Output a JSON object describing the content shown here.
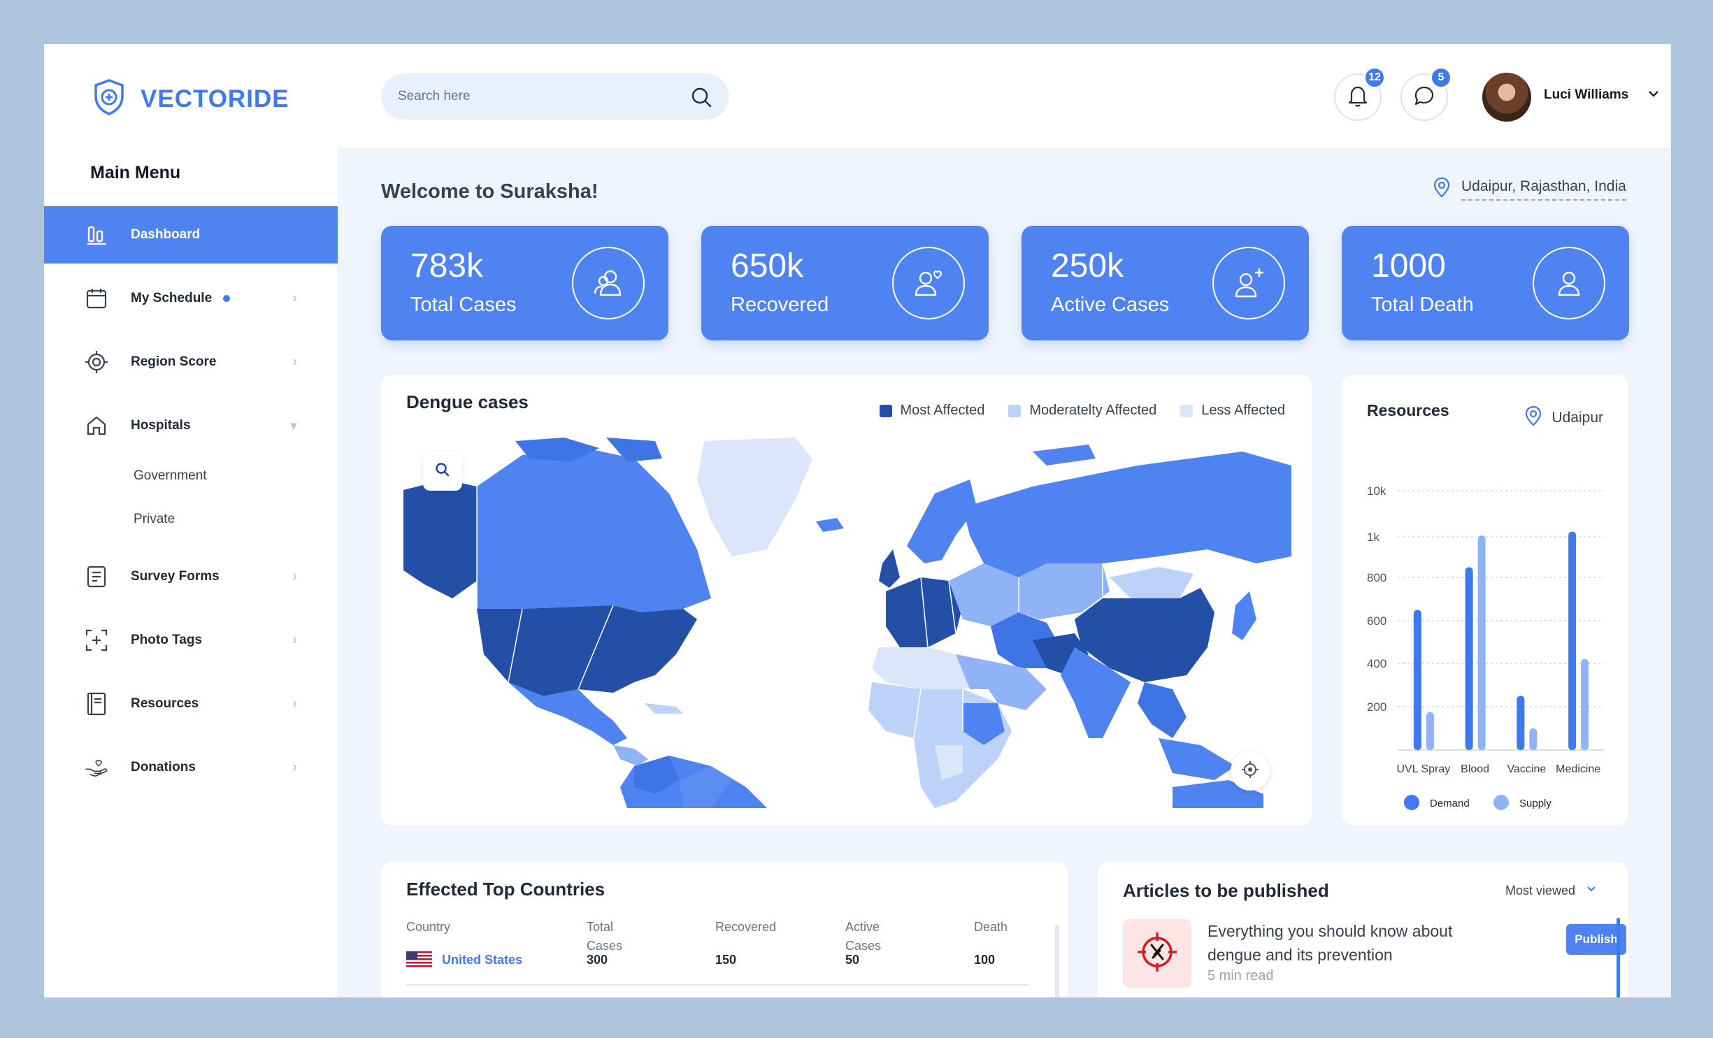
{
  "brand": {
    "name": "VECTORIDE"
  },
  "sidebar": {
    "title": "Main Menu",
    "items": [
      {
        "label": "Dashboard",
        "icon": "bar-chart-icon",
        "active": true
      },
      {
        "label": "My Schedule",
        "icon": "calendar-icon",
        "dot": true
      },
      {
        "label": "Region Score",
        "icon": "target-icon"
      },
      {
        "label": "Hospitals",
        "icon": "home-icon",
        "expanded": true
      },
      {
        "label": "Survey Forms",
        "icon": "document-icon"
      },
      {
        "label": "Photo Tags",
        "icon": "add-photo-icon"
      },
      {
        "label": "Resources",
        "icon": "book-icon"
      },
      {
        "label": "Donations",
        "icon": "donation-hand-icon"
      }
    ],
    "hospitals_sub": [
      "Government",
      "Private"
    ]
  },
  "topbar": {
    "search_placeholder": "Search here",
    "notifications_count": "12",
    "messages_count": "5",
    "user_name": "Luci Williams"
  },
  "main": {
    "welcome": "Welcome to Suraksha!",
    "location": "Udaipur, Rajasthan, India"
  },
  "stats": [
    {
      "value": "783k",
      "label": "Total Cases",
      "icon": "users-icon"
    },
    {
      "value": "650k",
      "label": "Recovered",
      "icon": "user-heart-icon"
    },
    {
      "value": "250k",
      "label": "Active Cases",
      "icon": "user-plus-icon"
    },
    {
      "value": "1000",
      "label": "Total Death",
      "icon": "user-icon"
    }
  ],
  "map": {
    "title": "Dengue cases",
    "legend": [
      {
        "label": "Most Affected",
        "color": "#244fa6"
      },
      {
        "label": "Moderatelty  Affected",
        "color": "#bcd2f8"
      },
      {
        "label": "Less  Affected",
        "color": "#dbe6fb"
      }
    ]
  },
  "resources": {
    "title": "Resources",
    "location": "Udaipur"
  },
  "chart_data": {
    "type": "bar",
    "title": "Resources",
    "categories": [
      "UVL Spray",
      "Blood",
      "Vaccine",
      "Medicine"
    ],
    "y_ticks": [
      "200",
      "400",
      "600",
      "800",
      "1k",
      "10k"
    ],
    "series": [
      {
        "name": "Demand",
        "color": "#3e79ee",
        "values": [
          650,
          850,
          250,
          2000
        ]
      },
      {
        "name": "Supply",
        "color": "#8fb3f6",
        "values": [
          175,
          1250,
          100,
          420
        ]
      }
    ],
    "legend_position": "bottom",
    "grid": true
  },
  "countries": {
    "title": "Effected Top Countries",
    "headers": [
      "Country",
      "Total\nCases",
      "Recovered",
      "Active\nCases",
      "Death"
    ],
    "rows": [
      {
        "country": "United States",
        "total": "300",
        "recovered": "150",
        "active": "50",
        "death": "100"
      }
    ]
  },
  "articles": {
    "title": "Articles to be published",
    "sort_label": "Most viewed",
    "items": [
      {
        "title": "Everything you should know about dengue and its prevention",
        "meta": "5 min read",
        "action": "Publish"
      }
    ]
  }
}
